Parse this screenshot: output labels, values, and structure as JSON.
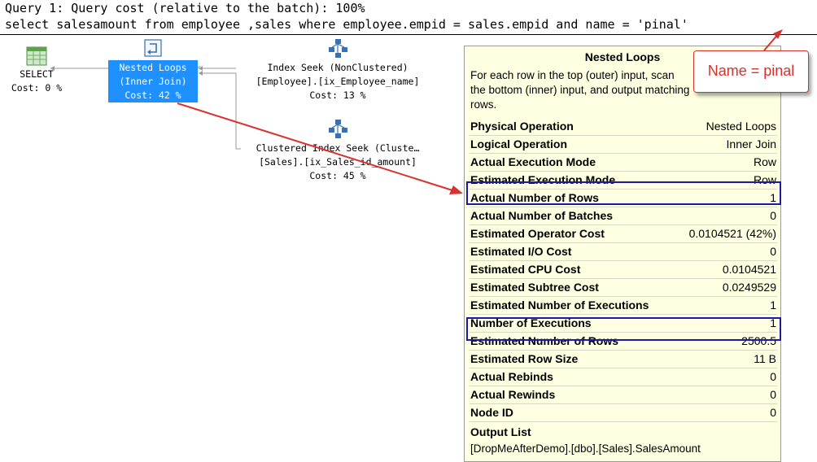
{
  "query": {
    "title": "Query 1: Query cost (relative to the batch): 100%",
    "sql": "select salesamount from employee ,sales where employee.empid = sales.empid and name = 'pinal'"
  },
  "plan": {
    "select": {
      "line1": "SELECT",
      "line2": "Cost: 0 %",
      "icon": "select-result-icon"
    },
    "nested_loops": {
      "line1": "Nested Loops",
      "line2": "(Inner Join)",
      "line3": "Cost: 42 %",
      "icon": "nested-loops-icon"
    },
    "index_seek": {
      "line1": "Index Seek (NonClustered)",
      "line2": "[Employee].[ix_Employee_name]",
      "line3": "Cost: 13 %",
      "icon": "index-seek-icon"
    },
    "clustered_seek": {
      "line1": "Clustered Index Seek (Cluste…",
      "line2": "[Sales].[ix_Sales_id_amount]",
      "line3": "Cost: 45 %",
      "icon": "clustered-index-seek-icon"
    }
  },
  "tooltip": {
    "title": "Nested Loops",
    "description": "For each row in the top (outer) input, scan the bottom (inner) input, and output matching rows.",
    "rows": [
      {
        "label": "Physical Operation",
        "value": "Nested Loops"
      },
      {
        "label": "Logical Operation",
        "value": "Inner Join"
      },
      {
        "label": "Actual Execution Mode",
        "value": "Row"
      },
      {
        "label": "Estimated Execution Mode",
        "value": "Row"
      },
      {
        "label": "Actual Number of Rows",
        "value": "1"
      },
      {
        "label": "Actual Number of Batches",
        "value": "0"
      },
      {
        "label": "Estimated Operator Cost",
        "value": "0.0104521 (42%)"
      },
      {
        "label": "Estimated I/O Cost",
        "value": "0"
      },
      {
        "label": "Estimated CPU Cost",
        "value": "0.0104521"
      },
      {
        "label": "Estimated Subtree Cost",
        "value": "0.0249529"
      },
      {
        "label": "Estimated Number of Executions",
        "value": "1"
      },
      {
        "label": "Number of Executions",
        "value": "1"
      },
      {
        "label": "Estimated Number of Rows",
        "value": "2500.5"
      },
      {
        "label": "Estimated Row Size",
        "value": "11 B"
      },
      {
        "label": "Actual Rebinds",
        "value": "0"
      },
      {
        "label": "Actual Rewinds",
        "value": "0"
      },
      {
        "label": "Node ID",
        "value": "0"
      }
    ],
    "output_label": "Output List",
    "output_value": "[DropMeAfterDemo].[dbo].[Sales].SalesAmount"
  },
  "callout": {
    "text": "Name = pinal"
  },
  "colors": {
    "tooltip_bg": "#ffffe1",
    "highlight_box": "#1a1aa6",
    "annotation_red": "#d9312c",
    "selected_node": "#1e90ff"
  }
}
